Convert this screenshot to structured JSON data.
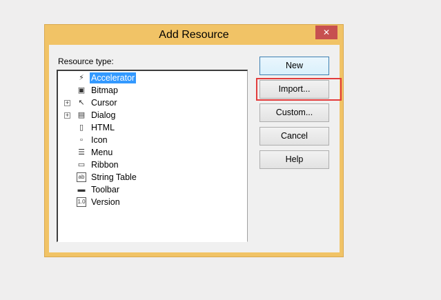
{
  "window": {
    "title": "Add Resource",
    "close_glyph": "✕"
  },
  "resource_type_label": "Resource type:",
  "tree": {
    "items": [
      {
        "label": "Accelerator",
        "icon": "accelerator-icon",
        "glyph": "⚡",
        "expandable": false,
        "selected": true
      },
      {
        "label": "Bitmap",
        "icon": "bitmap-icon",
        "glyph": "▣",
        "expandable": false,
        "selected": false
      },
      {
        "label": "Cursor",
        "icon": "cursor-icon",
        "glyph": "↖",
        "expandable": true,
        "selected": false
      },
      {
        "label": "Dialog",
        "icon": "dialog-icon",
        "glyph": "▤",
        "expandable": true,
        "selected": false
      },
      {
        "label": "HTML",
        "icon": "html-icon",
        "glyph": "▯",
        "expandable": false,
        "selected": false
      },
      {
        "label": "Icon",
        "icon": "icon-resource-icon",
        "glyph": "▫",
        "expandable": false,
        "selected": false
      },
      {
        "label": "Menu",
        "icon": "menu-icon",
        "glyph": "☰",
        "expandable": false,
        "selected": false
      },
      {
        "label": "Ribbon",
        "icon": "ribbon-icon",
        "glyph": "▭",
        "expandable": false,
        "selected": false
      },
      {
        "label": "String Table",
        "icon": "string-table-icon",
        "glyph": "ab",
        "expandable": false,
        "selected": false
      },
      {
        "label": "Toolbar",
        "icon": "toolbar-icon",
        "glyph": "▬",
        "expandable": false,
        "selected": false
      },
      {
        "label": "Version",
        "icon": "version-icon",
        "glyph": "1.0",
        "expandable": false,
        "selected": false
      }
    ],
    "expander_glyph": "+"
  },
  "buttons": {
    "new": "New",
    "import": "Import...",
    "custom": "Custom...",
    "cancel": "Cancel",
    "help": "Help"
  },
  "colors": {
    "frame": "#f1c366",
    "selection": "#3399ff",
    "highlight": "#e23b3b",
    "close": "#c75050"
  }
}
